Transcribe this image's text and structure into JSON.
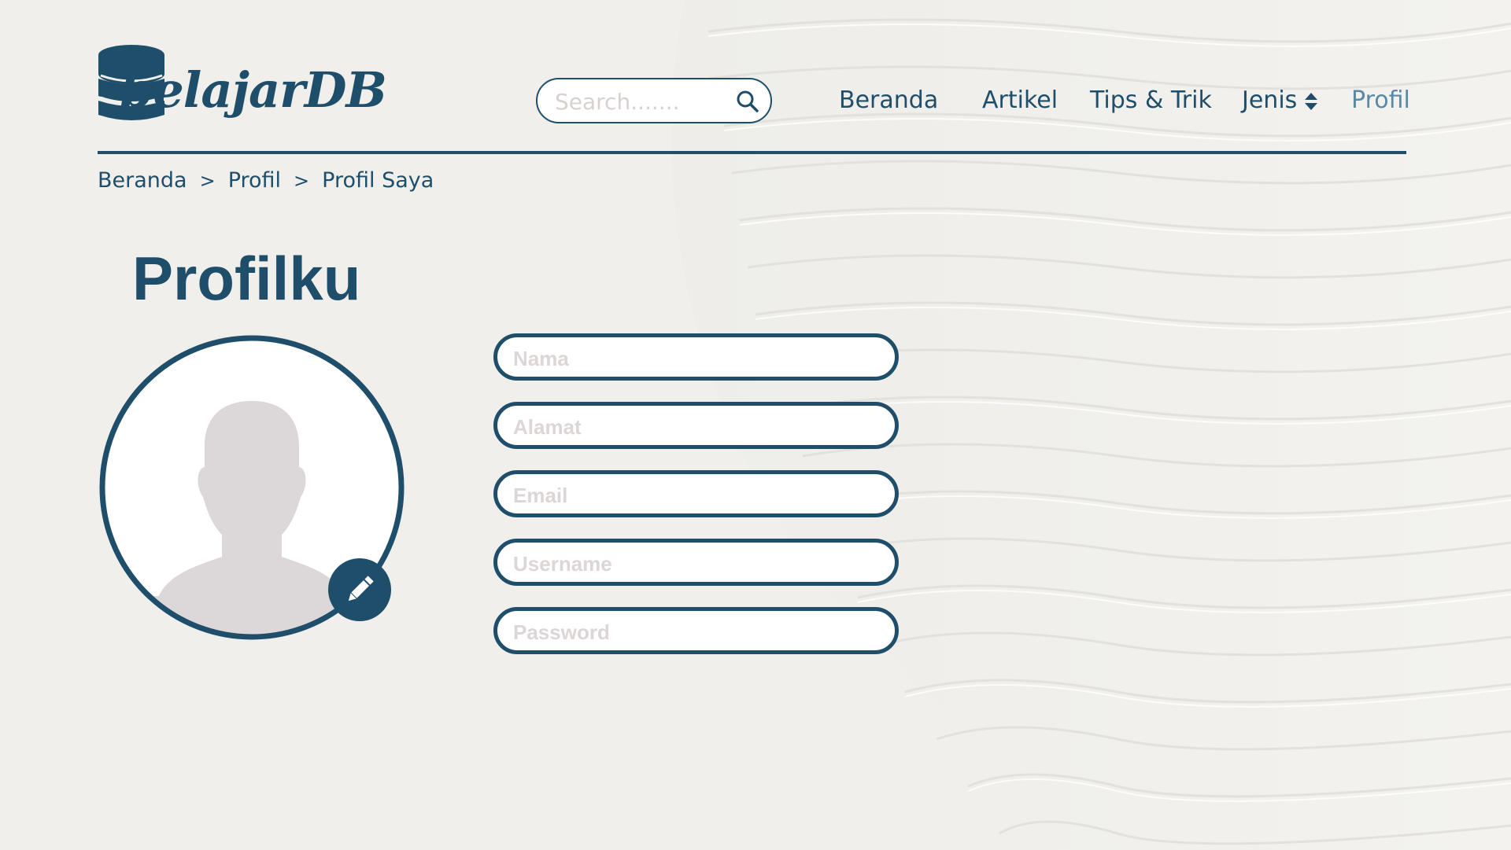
{
  "header": {
    "logo_text": "belajarDB",
    "search": {
      "placeholder": "Search......."
    },
    "nav": [
      {
        "label": "Beranda"
      },
      {
        "label": "Artikel"
      },
      {
        "label": "Tips & Trik"
      },
      {
        "label": "Jenis"
      },
      {
        "label": "Profil",
        "active": true
      }
    ]
  },
  "breadcrumb": {
    "items": [
      "Beranda",
      "Profil",
      "Profil Saya"
    ],
    "separator": ">"
  },
  "page_title": "Profilku",
  "profile_form": {
    "fields": [
      {
        "placeholder": "Nama"
      },
      {
        "placeholder": "Alamat"
      },
      {
        "placeholder": "Email"
      },
      {
        "placeholder": "Username"
      },
      {
        "placeholder": "Password"
      }
    ]
  },
  "colors": {
    "primary": "#1f4e6b",
    "active_nav": "#5a89a8",
    "background": "#f0efeb",
    "avatar_silhouette": "#dcd7d8",
    "placeholder_text": "#dcd6d6"
  },
  "icons": {
    "logo": "database-icon",
    "search": "search-icon",
    "jenis_caret": "sort-caret-icon",
    "avatar": "user-silhouette-icon",
    "edit": "pencil-icon"
  }
}
